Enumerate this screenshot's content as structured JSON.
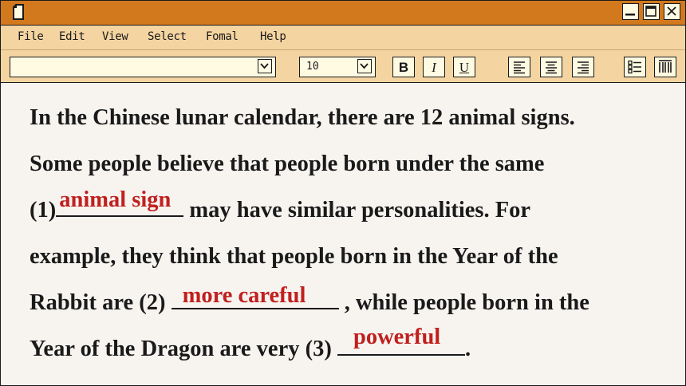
{
  "menu": {
    "items": [
      "File",
      "Edit",
      "View",
      "Select",
      "Fomal",
      "Help"
    ]
  },
  "toolbar": {
    "font_name": "",
    "font_size": "10",
    "bold_label": "B",
    "italic_label": "I",
    "underline_label": "U"
  },
  "document": {
    "line1": "In the Chinese lunar calendar, there are 12 animal signs.",
    "line2": "Some people believe that people born under the same",
    "line3_prefix": "(1)",
    "line3_suffix": " may have similar personalities. For",
    "line4": "example, they think that people born in the Year of the",
    "line5_prefix": "Rabbit are (2) ",
    "line5_suffix": " , while people born in the",
    "line6_prefix": "Year of the Dragon are very (3) ",
    "line6_suffix": ".",
    "answers": {
      "a1": "animal sign",
      "a2": "more careful",
      "a3": "powerful"
    }
  },
  "colors": {
    "titlebar": "#d2781d",
    "menubar": "#f4d4a0",
    "answer": "#c0201e",
    "page": "#f7f4f0"
  },
  "icons": {
    "window_controls": [
      "minimize-icon",
      "maximize-icon",
      "close-icon"
    ],
    "toolbar": [
      "align-left-icon",
      "align-center-icon",
      "align-right-icon",
      "bullet-list-icon",
      "columns-icon"
    ]
  }
}
